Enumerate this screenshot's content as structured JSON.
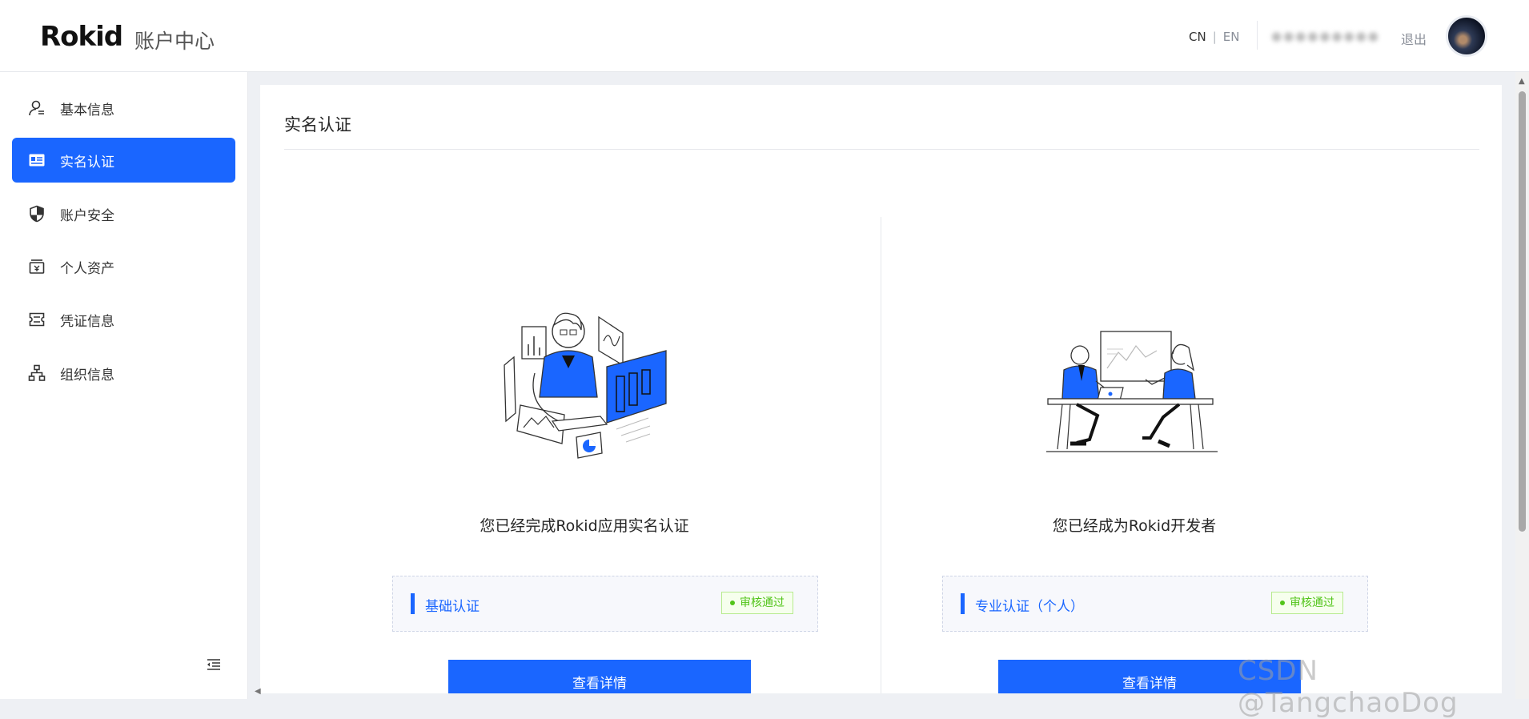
{
  "header": {
    "logo": "Rokid",
    "app_title": "账户中心",
    "lang_cn": "CN",
    "lang_sep": "|",
    "lang_en": "EN",
    "username": "●●●●●●●●●",
    "logout": "退出",
    "avatar_icon": "user-avatar"
  },
  "sidebar": {
    "items": [
      {
        "label": "基本信息",
        "icon": "user-icon",
        "active": false
      },
      {
        "label": "实名认证",
        "icon": "id-card-icon",
        "active": true
      },
      {
        "label": "账户安全",
        "icon": "shield-icon",
        "active": false
      },
      {
        "label": "个人资产",
        "icon": "wallet-icon",
        "active": false
      },
      {
        "label": "凭证信息",
        "icon": "ticket-icon",
        "active": false
      },
      {
        "label": "组织信息",
        "icon": "org-tree-icon",
        "active": false
      }
    ],
    "collapse_icon": "menu-fold-icon"
  },
  "main": {
    "title": "实名认证",
    "cards": [
      {
        "message": "您已经完成Rokid应用实名认证",
        "cert_name": "基础认证",
        "status": "审核通过",
        "button": "查看详情"
      },
      {
        "message": "您已经成为Rokid开发者",
        "cert_name": "专业认证（个人）",
        "status": "审核通过",
        "button": "查看详情"
      }
    ]
  },
  "watermark": "CSDN @TangchaoDog",
  "colors": {
    "primary": "#1a66ff",
    "success": "#52c41a"
  }
}
